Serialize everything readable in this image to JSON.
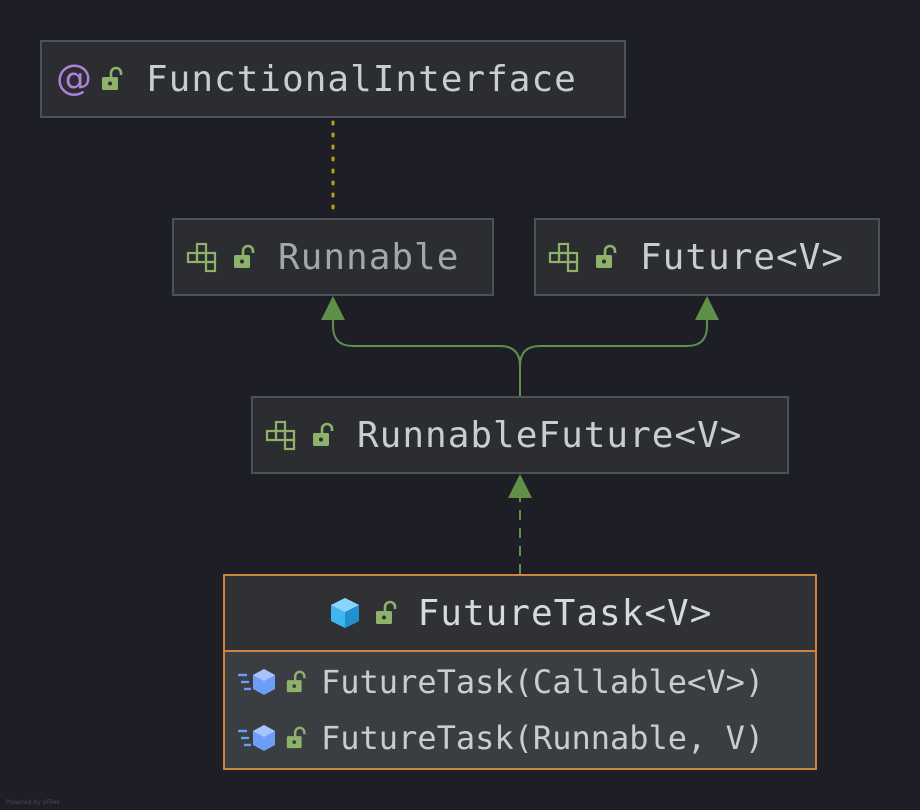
{
  "diagram": {
    "nodes": {
      "functional_interface": {
        "label": "FunctionalInterface",
        "kind": "annotation",
        "visibility": "public"
      },
      "runnable": {
        "label": "Runnable",
        "kind": "interface",
        "visibility": "public"
      },
      "future": {
        "label": "Future<V>",
        "kind": "interface",
        "visibility": "public"
      },
      "runnable_future": {
        "label": "RunnableFuture<V>",
        "kind": "interface",
        "visibility": "public"
      },
      "future_task": {
        "label": "FutureTask<V>",
        "kind": "class",
        "visibility": "public",
        "members": [
          {
            "label": "FutureTask(Callable<V>)",
            "kind": "constructor",
            "visibility": "public"
          },
          {
            "label": "FutureTask(Runnable, V)",
            "kind": "constructor",
            "visibility": "public"
          }
        ]
      }
    },
    "edges": [
      {
        "from": "runnable",
        "to": "functional_interface",
        "type": "annotated-by",
        "style": "dotted",
        "color": "#b9a316"
      },
      {
        "from": "runnable_future",
        "to": "runnable",
        "type": "extends",
        "style": "solid",
        "color": "#5f8f48"
      },
      {
        "from": "runnable_future",
        "to": "future",
        "type": "extends",
        "style": "solid",
        "color": "#5f8f48"
      },
      {
        "from": "future_task",
        "to": "runnable_future",
        "type": "implements",
        "style": "dashed",
        "color": "#5f8f48"
      }
    ],
    "credit": "Powered by yFiles"
  }
}
